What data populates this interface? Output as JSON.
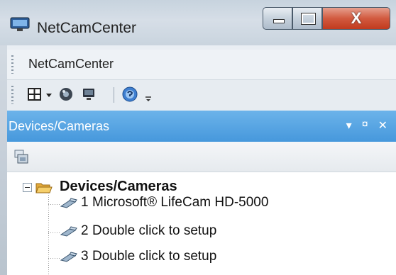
{
  "window": {
    "title": "NetCamCenter",
    "controls": {
      "minimize_icon": "minimize-icon",
      "maximize_icon": "maximize-icon",
      "close_glyph": "X"
    }
  },
  "menubar": {
    "items": [
      {
        "label": "NetCamCenter"
      }
    ]
  },
  "toolbar": {
    "icons": [
      "layout-grid-icon",
      "dropdown-arrow-icon",
      "camera-icon",
      "monitor-icon",
      "help-icon",
      "overflow-icon"
    ]
  },
  "panel": {
    "title": "Devices/Cameras",
    "controls": {
      "dropdown": "▾",
      "pin": "¤",
      "close": "✕"
    },
    "toolbar_icons": [
      "add-device-icon"
    ],
    "tree": {
      "root": {
        "label": "Devices/Cameras",
        "expanded": true
      },
      "items": [
        {
          "number": "1",
          "label": "Microsoft® LifeCam HD-5000"
        },
        {
          "number": "2",
          "label": "Double click to setup"
        },
        {
          "number": "3",
          "label": "Double click to setup"
        }
      ]
    }
  },
  "colors": {
    "panel_header": "#4698dc",
    "close_button": "#c13a1e"
  }
}
